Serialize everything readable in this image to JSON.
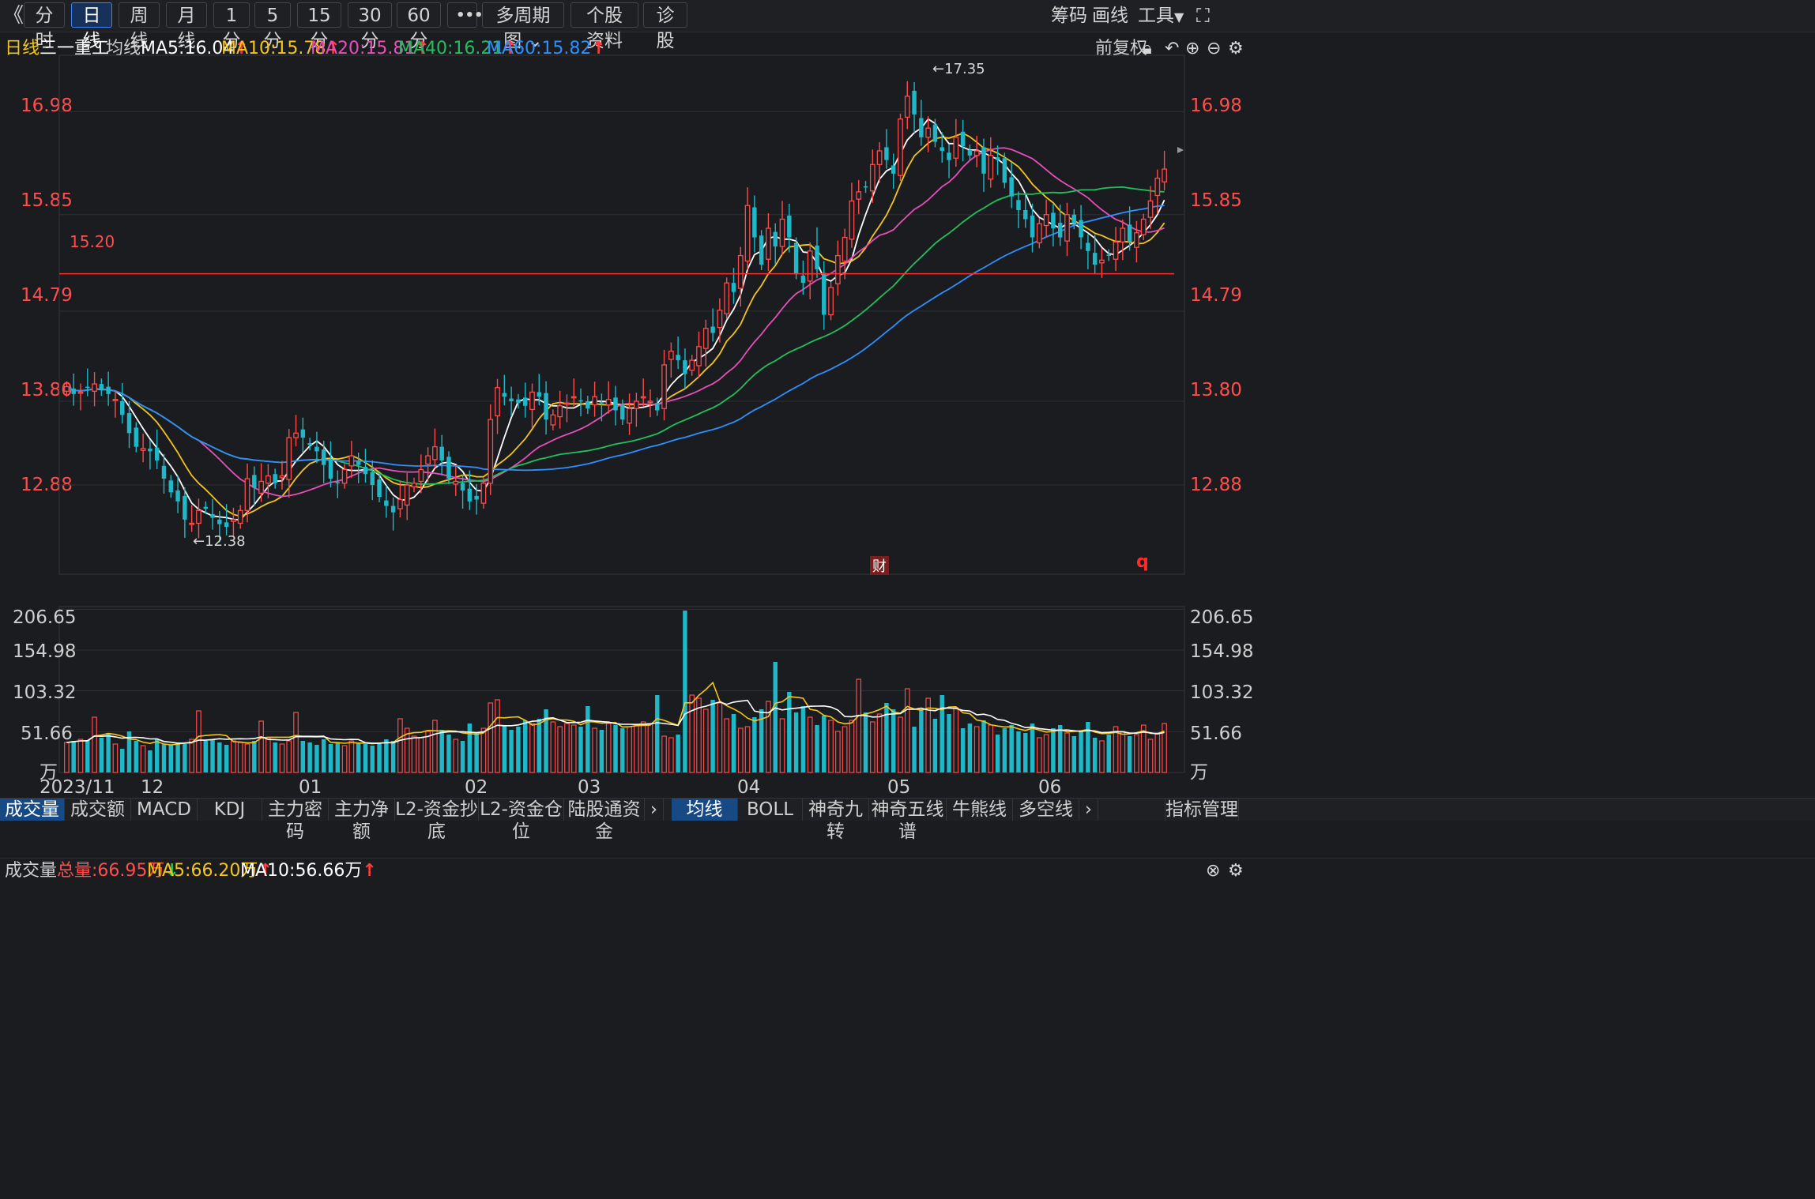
{
  "toolbar": {
    "back_icon": "double-chevron-left-icon",
    "periods": [
      "分时",
      "日线",
      "周线",
      "月线",
      "1分",
      "5分",
      "15分",
      "30分",
      "60分"
    ],
    "active_period": "日线",
    "more_label": "•••",
    "multi_period_label": "多周期图",
    "stock_info_label": "个股资料",
    "diagnose_label": "诊股",
    "chips_label": "筹码",
    "draw_label": "画线",
    "tools_label": "工具"
  },
  "ma_bar": {
    "period_label": "日线",
    "stock_name": "三一重工",
    "ma_label": "均线",
    "ma5": "MA5:16.04",
    "ma10": "MA10:15.78",
    "ma20": "MA20:15.81",
    "ma40": "MA40:16.21",
    "ma60": "MA60:15.82",
    "adjust_label": "前复权",
    "colors": {
      "ma5": "#ffffff",
      "ma10": "#f5c518",
      "ma20": "#e64fb8",
      "ma40": "#20c05c",
      "ma60": "#2f8fff"
    }
  },
  "price_axis": {
    "ticks": [
      "16.98",
      "15.85",
      "14.79",
      "13.80",
      "12.88"
    ]
  },
  "annotations": {
    "high_label": "←17.35",
    "low_label": "←12.38",
    "hline_label": "15.20",
    "finance_badge": "财",
    "q_marker": "q"
  },
  "volume_header": {
    "title": "成交量",
    "total": "总量:66.95万",
    "ma5": "MA5:66.20万",
    "ma10": "MA10:56.66万"
  },
  "volume_axis": {
    "ticks": [
      "206.65",
      "154.98",
      "103.32",
      "51.66"
    ],
    "unit": "万"
  },
  "x_axis": {
    "labels": [
      "2023/11",
      "12",
      "01",
      "02",
      "03",
      "04",
      "05",
      "06"
    ]
  },
  "bottom_tabs_left": [
    "成交量",
    "成交额",
    "MACD",
    "KDJ",
    "主力密码",
    "主力净额",
    "L2-资金抄底",
    "L2-资金仓位",
    "陆股通资金"
  ],
  "bottom_tabs_right": [
    "均线",
    "BOLL",
    "神奇九转",
    "神奇五线谱",
    "牛熊线",
    "多空线"
  ],
  "indicator_manage": "指标管理",
  "chart_data": {
    "type": "candlestick",
    "title": "三一重工 日线",
    "y_range": [
      11.9,
      17.6
    ],
    "reference_line": 15.2,
    "highest": 17.35,
    "lowest": 12.38,
    "closes": [
      13.96,
      13.88,
      13.9,
      13.95,
      13.99,
      13.92,
      13.88,
      13.82,
      13.65,
      13.45,
      13.3,
      13.28,
      13.25,
      13.15,
      12.95,
      12.8,
      12.7,
      12.5,
      12.46,
      12.6,
      12.62,
      12.52,
      12.45,
      12.42,
      12.5,
      12.6,
      12.95,
      12.85,
      12.92,
      12.98,
      12.9,
      12.98,
      13.4,
      13.45,
      13.4,
      13.32,
      13.25,
      13.1,
      12.95,
      12.9,
      13.05,
      13.2,
      13.1,
      13.0,
      12.88,
      12.75,
      12.65,
      12.58,
      12.72,
      12.88,
      12.9,
      13.05,
      13.2,
      13.3,
      13.15,
      12.95,
      12.92,
      12.82,
      12.7,
      12.72,
      12.9,
      13.6,
      13.95,
      13.85,
      13.8,
      13.78,
      13.75,
      13.9,
      13.85,
      13.6,
      13.65,
      13.75,
      13.78,
      13.85,
      13.8,
      13.72,
      13.85,
      13.78,
      13.82,
      13.7,
      13.6,
      13.72,
      13.8,
      13.85,
      13.8,
      13.7,
      14.2,
      14.35,
      14.25,
      14.1,
      14.25,
      14.4,
      14.6,
      14.55,
      14.8,
      15.1,
      15.0,
      15.4,
      15.95,
      15.6,
      15.3,
      15.7,
      15.5,
      15.8,
      15.6,
      15.2,
      15.1,
      15.45,
      15.25,
      14.75,
      15.05,
      15.4,
      15.6,
      16.0,
      16.1,
      16.15,
      16.4,
      16.55,
      16.45,
      16.3,
      16.9,
      17.15,
      16.95,
      16.7,
      16.8,
      16.65,
      16.55,
      16.45,
      16.7,
      16.6,
      16.5,
      16.55,
      16.3,
      16.5,
      16.45,
      16.2,
      16.05,
      15.9,
      15.8,
      15.6,
      15.75,
      15.85,
      15.7,
      15.6,
      15.85,
      15.75,
      15.6,
      15.45,
      15.3,
      15.35,
      15.4,
      15.55,
      15.7,
      15.55,
      15.65,
      15.8,
      16.0,
      16.25,
      16.35
    ],
    "volume_range": [
      0,
      210
    ],
    "volumes": [
      38,
      40,
      42,
      41,
      70,
      44,
      50,
      36,
      30,
      52,
      40,
      34,
      28,
      42,
      36,
      35,
      38,
      36,
      42,
      78,
      40,
      42,
      38,
      35,
      40,
      38,
      36,
      40,
      65,
      44,
      38,
      36,
      40,
      76,
      40,
      38,
      35,
      42,
      36,
      38,
      34,
      40,
      38,
      36,
      34,
      38,
      42,
      40,
      68,
      56,
      46,
      44,
      52,
      66,
      54,
      48,
      42,
      40,
      62,
      50,
      56,
      88,
      92,
      60,
      54,
      58,
      66,
      62,
      68,
      80,
      64,
      58,
      62,
      60,
      58,
      84,
      56,
      54,
      62,
      60,
      56,
      58,
      60,
      64,
      62,
      98,
      46,
      44,
      48,
      205,
      98,
      94,
      80,
      92,
      88,
      68,
      74,
      56,
      58,
      70,
      80,
      90,
      140,
      68,
      102,
      76,
      84,
      70,
      60,
      72,
      66,
      52,
      58,
      66,
      118,
      76,
      64,
      74,
      88,
      80,
      70,
      106,
      58,
      80,
      94,
      68,
      98,
      74,
      82,
      56,
      62,
      58,
      66,
      60,
      48,
      56,
      60,
      52,
      50,
      62,
      44,
      48,
      56,
      60,
      50,
      46,
      52,
      64,
      44,
      40,
      48,
      58,
      52,
      46,
      48,
      60,
      42,
      50,
      62,
      52,
      104,
      66
    ]
  }
}
